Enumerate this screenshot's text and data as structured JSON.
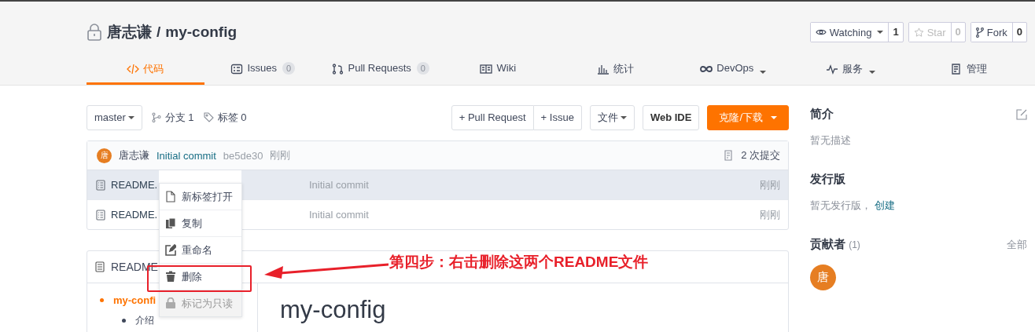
{
  "repo": {
    "owner": "唐志谦",
    "separator": "/",
    "name": "my-config"
  },
  "repo_actions": [
    {
      "label": "Watching",
      "count": "1",
      "kind": "watch",
      "disabled": false
    },
    {
      "label": "Star",
      "count": "0",
      "kind": "star",
      "disabled": true
    },
    {
      "label": "Fork",
      "count": "0",
      "kind": "fork",
      "disabled": false
    }
  ],
  "tabs": [
    {
      "label": "代码",
      "kind": "code",
      "caret": false,
      "selected": true
    },
    {
      "label": "Issues",
      "kind": "issues",
      "count": "0",
      "caret": false,
      "selected": false
    },
    {
      "label": "Pull Requests",
      "kind": "pr",
      "count": "0",
      "caret": false,
      "selected": false
    },
    {
      "label": "Wiki",
      "kind": "wiki",
      "caret": false,
      "selected": false
    },
    {
      "label": "统计",
      "kind": "stats",
      "caret": false,
      "selected": false
    },
    {
      "label": "DevOps",
      "kind": "devops",
      "caret": true,
      "selected": false
    },
    {
      "label": "服务",
      "kind": "service",
      "caret": true,
      "selected": false
    },
    {
      "label": "管理",
      "kind": "manage",
      "caret": false,
      "selected": false
    }
  ],
  "toolbar": {
    "branch": "master",
    "branches": "分支 1",
    "tags": "标签 0",
    "new_pr": "+ Pull Request",
    "new_issue": "+ Issue",
    "file_menu": "文件",
    "web_ide": "Web IDE",
    "clone": "克隆/下载"
  },
  "last_commit": {
    "avatar": "唐",
    "author": "唐志谦",
    "message": "Initial commit",
    "hash": "be5de30",
    "time": "刚刚",
    "commits": "2 次提交"
  },
  "files": [
    {
      "name": "README.",
      "message": "Initial commit",
      "time": "刚刚",
      "selected": true
    },
    {
      "name": "README.",
      "message": "Initial commit",
      "time": "刚刚",
      "selected": false
    }
  ],
  "context_menu": [
    {
      "label": "新标签打开",
      "kind": "page",
      "disabled": false
    },
    {
      "label": "复制",
      "kind": "copy",
      "disabled": false
    },
    {
      "label": "重命名",
      "kind": "edit",
      "disabled": false
    },
    {
      "label": "删除",
      "kind": "trash",
      "disabled": false
    },
    {
      "label": "标记为只读",
      "kind": "lock",
      "disabled": true
    }
  ],
  "annotation": {
    "text": "第四步：右击删除这两个README文件"
  },
  "readme": {
    "title": "README",
    "toc": [
      {
        "label": "my-confi",
        "children": [
          {
            "label": "介绍"
          }
        ]
      }
    ],
    "heading": "my-config"
  },
  "sidebar": {
    "about_title": "简介",
    "about_text": "暂无描述",
    "releases_title": "发行版",
    "releases_text": "暂无发行版，",
    "releases_link": "创建",
    "contributors_title": "贡献者",
    "contributors_count": "(1)",
    "contributors_all": "全部",
    "contributors": [
      {
        "initial": "唐"
      }
    ]
  }
}
